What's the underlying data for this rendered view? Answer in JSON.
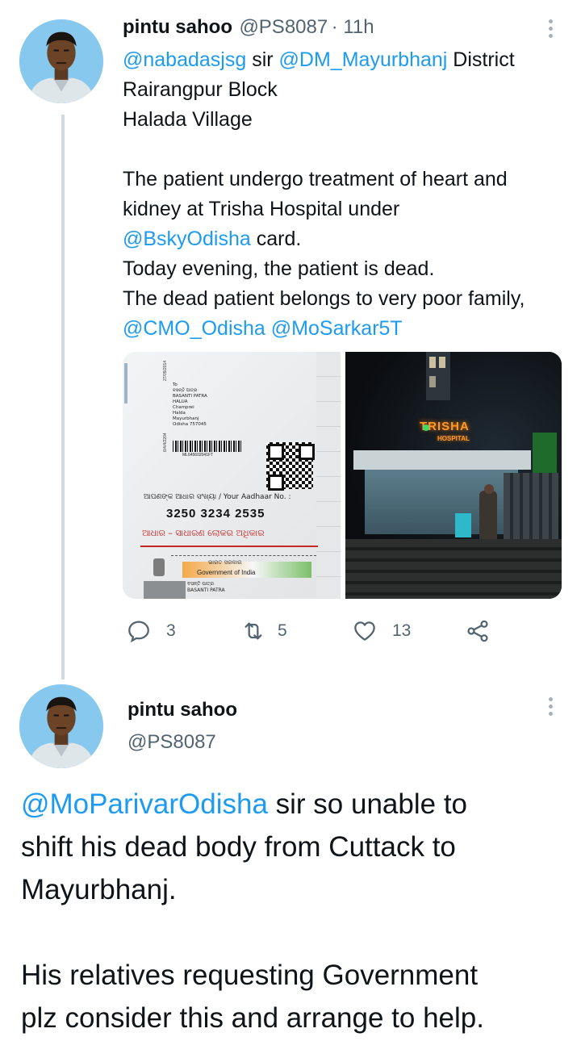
{
  "tweet1": {
    "name": "pintu sahoo",
    "handle": "@PS8087",
    "time": "· 11h",
    "mention1": "@nabadasjsg",
    "word_sir": " sir ",
    "mention2": "@DM_Mayurbhanj",
    "word_district": " District",
    "line2": "Rairangpur Block",
    "line3": "Halada Village",
    "line4": "The patient undergo treatment of heart and",
    "line5": "kidney at Trisha Hospital under",
    "mention3": "@BskyOdisha",
    "word_card": " card.",
    "line7": "Today evening, the patient is dead.",
    "line8": "The dead patient belongs to very poor family,",
    "mention4": "@CMO_Odisha",
    "mention5": "@MoSarkar5T",
    "card": {
      "to": "To",
      "odia_name": "ବସନ୍ତି ପାତ୍ର",
      "name": "BASANTI PATRA",
      "addr1": "HALUA",
      "addr2": "Champrei",
      "addr3": "Halda",
      "addr4": "Mayurbhanj",
      "addr5": "Odisha 757045",
      "barcode_text": "ML645602041FT",
      "side_num1": "27/05/2014",
      "side_num2": "6/4/4/2204",
      "your_label": "ଆପଣଙ୍କ ଆଧାର ସଂଖ୍ୟା / Your Aadhaar No. :",
      "aadhaar_no": "3250 3234 2535",
      "odia_slogan": "ଆଧାର – ସାଧାରଣ ଲୋକର ଅଧିକାର",
      "odia_gov": "ଭାରତ ସରକାର",
      "gov_india": "Government of India",
      "odia_name2": "ବସନ୍ତି ପାତ୍ର",
      "name2": "BASANTI PATRA"
    },
    "hospital": {
      "sign1": "TRISHA",
      "sign2": "HOSPITAL"
    },
    "replies": "3",
    "retweets": "5",
    "likes": "13"
  },
  "tweet2": {
    "name": "pintu sahoo",
    "handle": "@PS8087",
    "mention": "@MoParivarOdisha",
    "line1_rest": " sir so unable to",
    "line2": "shift his dead body from Cuttack to",
    "line3": "Mayurbhanj.",
    "line4": "His relatives requesting Government",
    "line5": "plz consider this and arrange to help."
  },
  "colors": {
    "link": "#1d9bf0",
    "secondary": "#536471",
    "thread": "#cfd9de"
  },
  "icons": [
    "reply-icon",
    "retweet-icon",
    "like-icon",
    "share-icon",
    "more-icon"
  ]
}
